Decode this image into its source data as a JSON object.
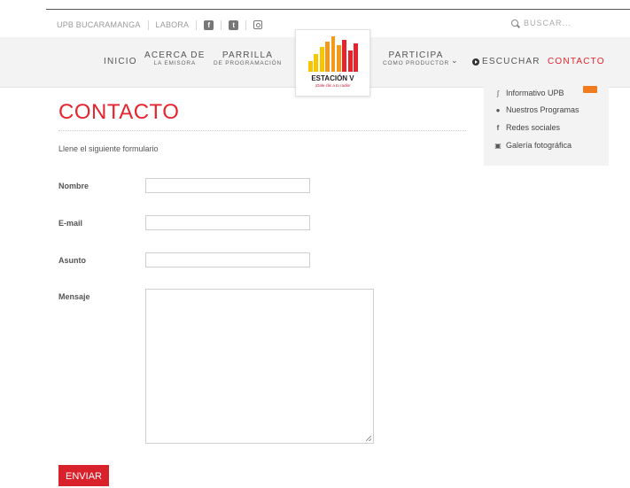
{
  "topbar": {
    "links": [
      "UPB BUCARAMANGA",
      "LABORA"
    ],
    "social_icons": [
      "facebook-icon",
      "twitter-icon",
      "instagram-icon"
    ],
    "search_placeholder": "BUSCAR..."
  },
  "nav": {
    "items": [
      {
        "main": "INICIO",
        "sub": ""
      },
      {
        "main": "ACERCA DE",
        "sub": "LA EMISORA"
      },
      {
        "main": "PARRILLA",
        "sub": "DE PROGRAMACIÓN"
      },
      {
        "main": "PARTICIPA",
        "sub": "COMO PRODUCTOR"
      },
      {
        "main": "ESCUCHAR",
        "sub": ""
      },
      {
        "main": "CONTACTO",
        "sub": ""
      }
    ],
    "active_color": "#e5242e"
  },
  "logo": {
    "name": "ESTACIÓN V",
    "tagline": "¡Dale clic a tu radio!",
    "bar_colors": [
      "#f7c600",
      "#f39a1c",
      "#e5242e"
    ]
  },
  "sidebar": {
    "items": [
      {
        "label": "Informativo UPB",
        "icon": "rss-icon"
      },
      {
        "label": "Nuestros Programas",
        "icon": "microphone-icon"
      },
      {
        "label": "Redes sociales",
        "icon": "facebook-icon"
      },
      {
        "label": "Galería fotográfica",
        "icon": "image-icon"
      }
    ]
  },
  "page": {
    "title": "CONTACTO",
    "intro": "Llene el siguiente formulario"
  },
  "form": {
    "fields": {
      "nombre": {
        "label": "Nombre",
        "value": ""
      },
      "email": {
        "label": "E-mail",
        "value": ""
      },
      "asunto": {
        "label": "Asunto",
        "value": ""
      },
      "mensaje": {
        "label": "Mensaje",
        "value": ""
      }
    },
    "submit_label": "ENVIAR"
  },
  "colors": {
    "accent": "#e5242e",
    "button": "#d8212b",
    "badge": "#f07c1f"
  }
}
